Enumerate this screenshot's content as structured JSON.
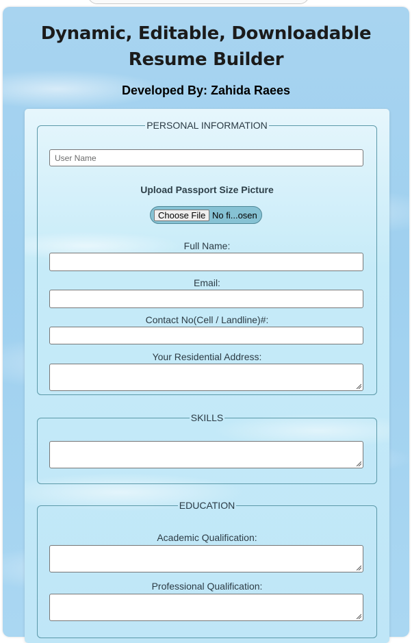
{
  "header": {
    "title": "Dynamic, Editable, Downloadable Resume Builder",
    "developer": "Developed By: Zahida Raees"
  },
  "personal": {
    "legend": "PERSONAL INFORMATION",
    "username_placeholder": "User Name",
    "upload_label": "Upload Passport Size Picture",
    "choose_file_label": "Choose File",
    "file_status": "No fi...osen",
    "full_name_label": "Full Name:",
    "email_label": "Email:",
    "contact_label": "Contact No(Cell / Landline)#:",
    "address_label": "Your Residential Address:"
  },
  "skills": {
    "legend": "SKILLS"
  },
  "education": {
    "legend": "EDUCATION",
    "academic_label": "Academic Qualification:",
    "professional_label": "Professional Qualification:"
  },
  "colors": {
    "page_background": "#a8d4f0",
    "card_background": "#c6ebf8",
    "fieldset_border": "#5a98a8",
    "file_pill": "#86c2d4"
  }
}
